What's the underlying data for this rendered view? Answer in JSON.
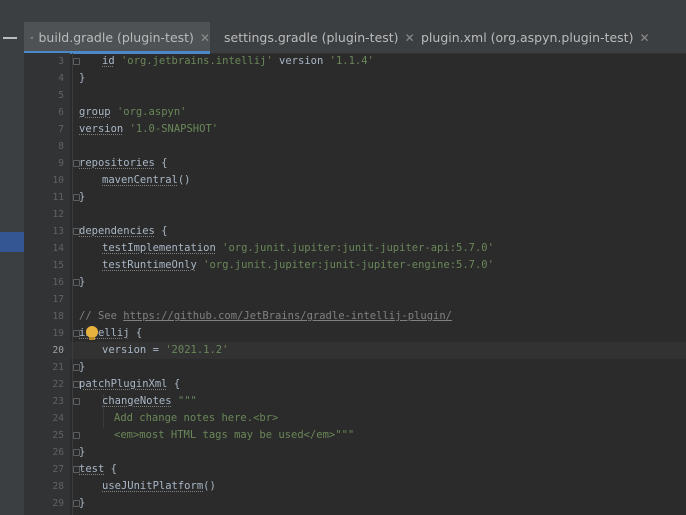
{
  "tabs": [
    {
      "label": "build.gradle (plugin-test)",
      "icon": "gradle-icon",
      "active": true
    },
    {
      "label": "settings.gradle (plugin-test)",
      "icon": "gradle-icon",
      "active": false
    },
    {
      "label": "plugin.xml (org.aspyn.plugin-test)",
      "icon": "xml-icon",
      "active": false
    }
  ],
  "close_glyph": "✕",
  "editor": {
    "current_line": 20,
    "lines": [
      {
        "n": "3"
      },
      {
        "n": "4"
      },
      {
        "n": "5"
      },
      {
        "n": "6"
      },
      {
        "n": "7"
      },
      {
        "n": "8"
      },
      {
        "n": "9"
      },
      {
        "n": "10"
      },
      {
        "n": "11"
      },
      {
        "n": "12"
      },
      {
        "n": "13"
      },
      {
        "n": "14"
      },
      {
        "n": "15"
      },
      {
        "n": "16"
      },
      {
        "n": "17"
      },
      {
        "n": "18"
      },
      {
        "n": "19"
      },
      {
        "n": "20"
      },
      {
        "n": "21"
      },
      {
        "n": "22"
      },
      {
        "n": "23"
      },
      {
        "n": "24"
      },
      {
        "n": "25"
      },
      {
        "n": "26"
      },
      {
        "n": "27"
      },
      {
        "n": "28"
      },
      {
        "n": "29"
      }
    ],
    "code": {
      "l3a": "id",
      "l3b": "'org.jetbrains.intellij'",
      "l3c": "version",
      "l3d": "'1.1.4'",
      "l4": "}",
      "l6a": "group",
      "l6b": "'org.aspyn'",
      "l7a": "version",
      "l7b": "'1.0-SNAPSHOT'",
      "l9a": "repositories",
      "l9b": "{",
      "l10a": "mavenCentral",
      "l10b": "()",
      "l11": "}",
      "l13a": "dependencies",
      "l13b": "{",
      "l14a": "testImplementation",
      "l14b": "'org.junit.jupiter:junit-jupiter-api:5.7.0'",
      "l15a": "testRuntimeOnly",
      "l15b": "'org.junit.jupiter:junit-jupiter-engine:5.7.0'",
      "l16": "}",
      "l18a": "// See",
      "l18b": "https://github.com/JetBrains/gradle-intellij-plugin/",
      "l19a": "intellij",
      "l19b": "{",
      "l20a": "version =",
      "l20b": "'2021.1.2'",
      "l21": "}",
      "l22a": "patchPluginXml",
      "l22b": "{",
      "l23a": "changeNotes",
      "l23b": "\"\"\"",
      "l24": "Add change notes here.<br>",
      "l25a": "<em>most HTML tags may be used</em>",
      "l25b": "\"\"\"",
      "l26": "}",
      "l27a": "test",
      "l27b": "{",
      "l28a": "useJUnitPlatform",
      "l28b": "()",
      "l29": "}"
    }
  }
}
